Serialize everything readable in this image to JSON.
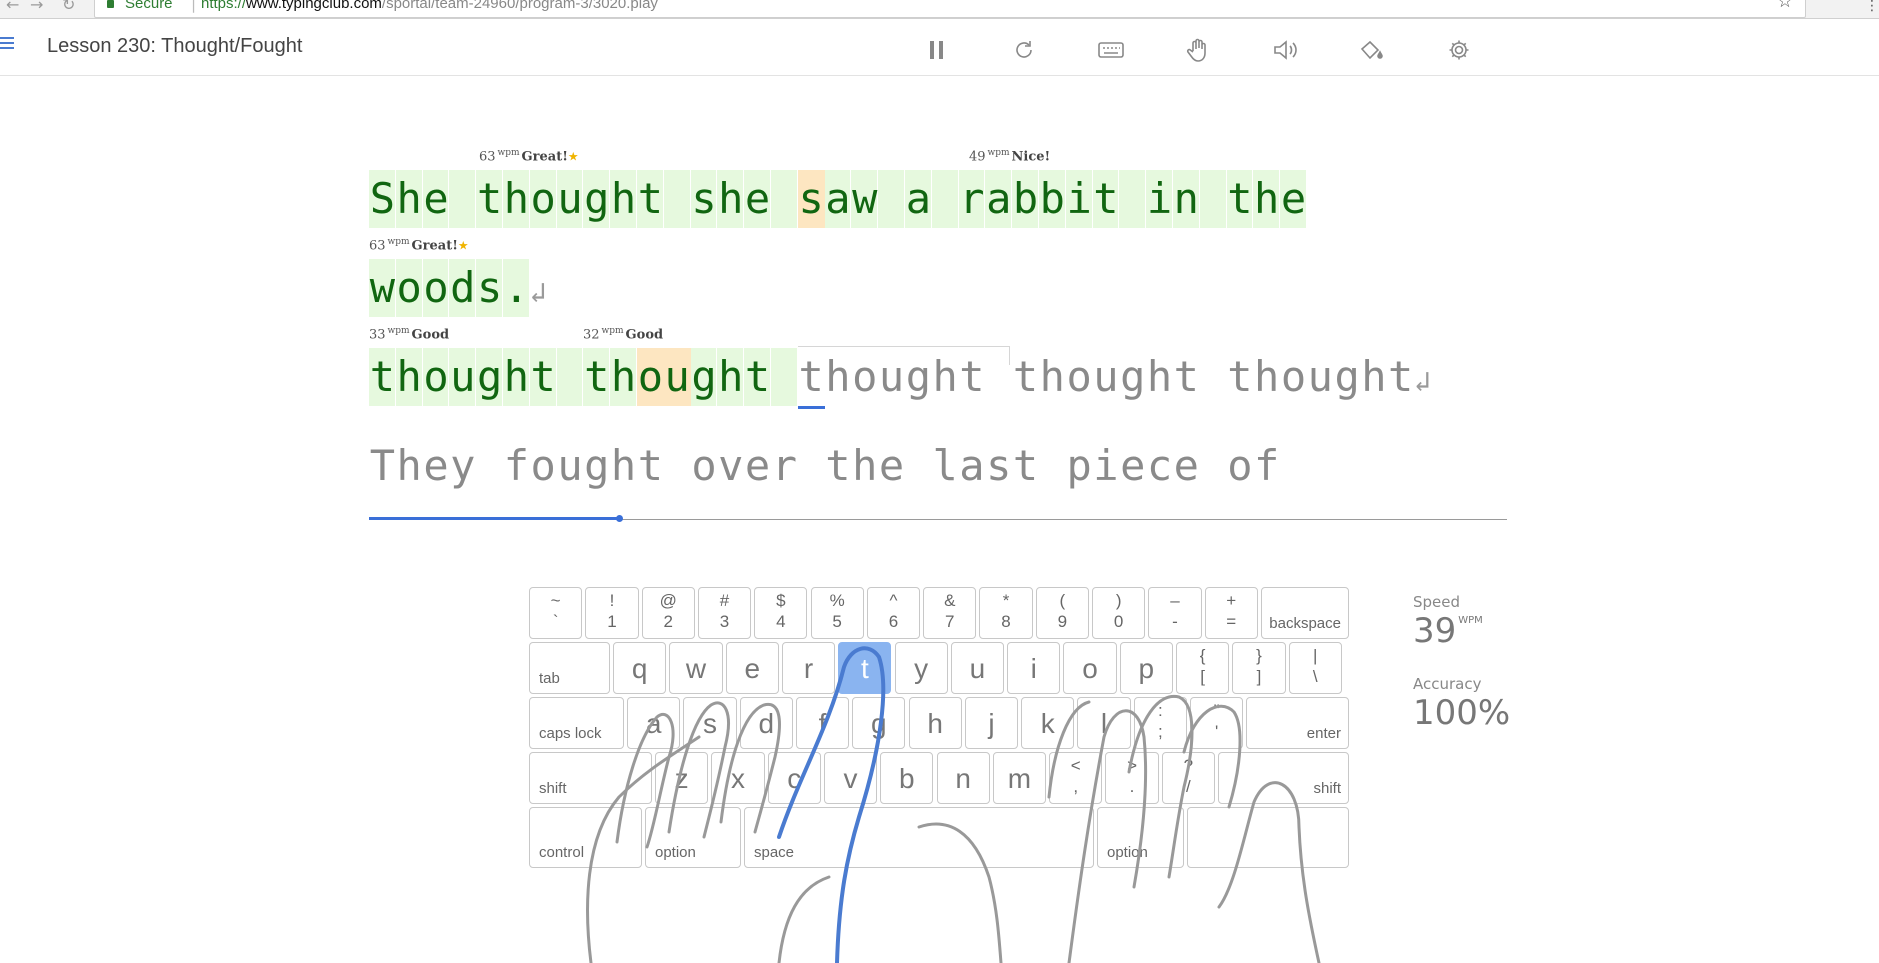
{
  "browser": {
    "secure_label": "Secure",
    "url_scheme": "https://",
    "url_host": "www.typingclub.com",
    "url_path": "/sportal/team-24960/program-3/3020.play"
  },
  "header": {
    "lesson_title": "Lesson 230: Thought/Fought",
    "tools": [
      "pause-icon",
      "restart-icon",
      "keyboard-icon",
      "hand-icon",
      "sound-icon",
      "theme-icon",
      "settings-icon"
    ]
  },
  "text": {
    "line1": "She thought she saw a rabbit in the",
    "line2": "woods.",
    "line3_done": "thought thought ",
    "line3_rest": "thought thought thought",
    "line4": "They fought over the last piece of",
    "return_symbol": "↲",
    "line1_fixed_index": 16,
    "line3_fixed_indices": [
      10,
      11
    ],
    "wpm_unit": "wpm",
    "badges": [
      {
        "wpm": "63",
        "label": "Great!",
        "star": true
      },
      {
        "wpm": "49",
        "label": "Nice!",
        "star": false
      },
      {
        "wpm": "63",
        "label": "Great!",
        "star": true
      },
      {
        "wpm": "33",
        "label": "Good",
        "star": false
      },
      {
        "wpm": "32",
        "label": "Good",
        "star": false
      }
    ],
    "progress_fraction": 0.22
  },
  "keyboard": {
    "highlight_key": "t",
    "row1": [
      [
        "~",
        "`"
      ],
      [
        "!",
        "1"
      ],
      [
        "@",
        "2"
      ],
      [
        "#",
        "3"
      ],
      [
        "$",
        "4"
      ],
      [
        "%",
        "5"
      ],
      [
        "^",
        "6"
      ],
      [
        "&",
        "7"
      ],
      [
        "*",
        "8"
      ],
      [
        "(",
        "9"
      ],
      [
        ")",
        "0"
      ],
      [
        "–",
        "-"
      ],
      [
        "+",
        "="
      ]
    ],
    "backspace": "backspace",
    "tab": "tab",
    "row2": [
      "q",
      "w",
      "e",
      "r",
      "t",
      "y",
      "u",
      "i",
      "o",
      "p"
    ],
    "row2_sym": [
      [
        "{",
        "["
      ],
      [
        "}",
        "]"
      ],
      [
        "|",
        "\\"
      ]
    ],
    "caps": "caps lock",
    "row3": [
      "a",
      "s",
      "d",
      "f",
      "g",
      "h",
      "j",
      "k",
      "l"
    ],
    "row3_sym": [
      [
        ":",
        ";"
      ],
      [
        "\"",
        "'"
      ]
    ],
    "enter": "enter",
    "shift_left": "shift",
    "row4": [
      "z",
      "x",
      "c",
      "v",
      "b",
      "n",
      "m"
    ],
    "row4_sym": [
      [
        "<",
        ","
      ],
      [
        ">",
        "."
      ],
      [
        "?",
        "/"
      ]
    ],
    "shift_right": "shift",
    "control": "control",
    "option_left": "option",
    "space": "space",
    "option_right": "option"
  },
  "stats": {
    "speed_label": "Speed",
    "speed_value": "39",
    "speed_unit": "WPM",
    "accuracy_label": "Accuracy",
    "accuracy_value": "100%"
  },
  "colors": {
    "correct_bg": "#e6f9de",
    "correct_fg": "#116611",
    "fixed_bg": "#fde6c1",
    "accent": "#3a6fd8",
    "highlight_key": "#8ab4f0"
  }
}
